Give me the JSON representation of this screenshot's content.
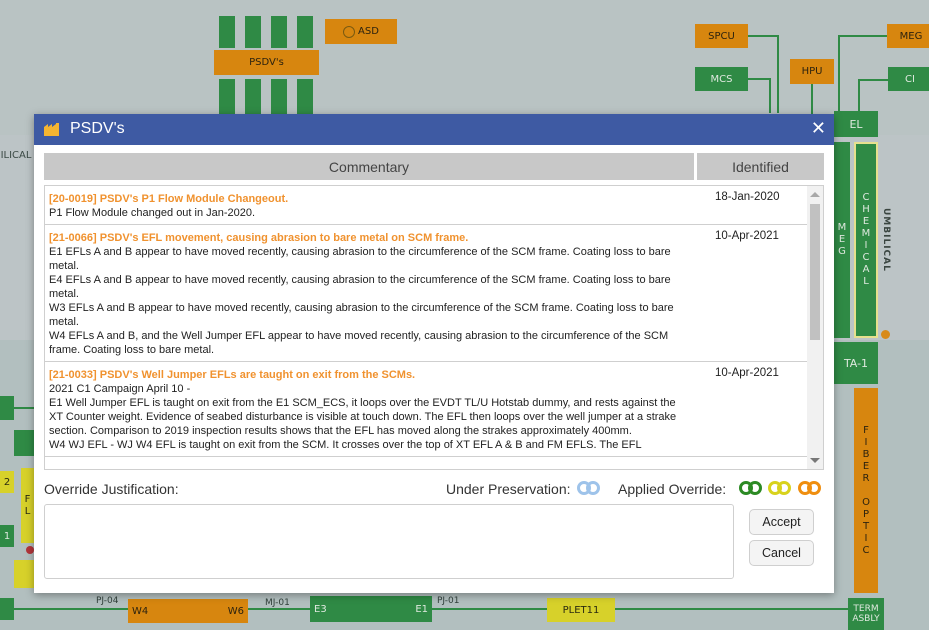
{
  "background": {
    "labels": {
      "asd": "ASD",
      "psdvs": "PSDV's",
      "spcu": "SPCU",
      "meg": "MEG",
      "mcs": "MCS",
      "hpu": "HPU",
      "ci": "CI",
      "ilical": "ILICAL",
      "el": "EL",
      "meg_vertical": "MEG",
      "chemical": "CHEMICAL",
      "umbilical": "UMBILICAL",
      "ta1": "TA-1",
      "fiber_optic": "FIBER OPTIC",
      "term": "TERM",
      "asbly": "ASBLY",
      "pj04": "PJ-04",
      "w4": "W4",
      "w6": "W6",
      "mj01": "MJ-01",
      "e3": "E3",
      "e1": "E1",
      "pj01": "PJ-01",
      "plet11": "PLET11",
      "num2": "2",
      "num3": "3",
      "num1": "1",
      "fl": "FL"
    }
  },
  "dialog": {
    "title": "PSDV's",
    "close_symbol": "✕",
    "columns": {
      "commentary": "Commentary",
      "identified": "Identified"
    },
    "entries": [
      {
        "title": "[20-0019] PSDV's P1 Flow Module Changeout.",
        "body": "P1 Flow Module changed out in Jan-2020.",
        "date": "18-Jan-2020"
      },
      {
        "title": "[21-0066] PSDV's EFL movement, causing abrasion to bare metal on SCM frame.",
        "body": "E1 EFLs A and B appear to have moved recently, causing abrasion to the circumference of the SCM frame. Coating loss to bare metal.\nE4 EFLs A and B appear to have moved recently, causing abrasion to the circumference of the SCM frame. Coating loss to bare metal.\nW3 EFLs A and B appear to have moved recently, causing abrasion to the circumference of the SCM frame. Coating loss to bare metal.\nW4 EFLs A and B, and the Well Jumper EFL appear to have moved recently, causing abrasion to the circumference of the SCM frame. Coating loss to bare metal.",
        "date": "10-Apr-2021"
      },
      {
        "title": "[21-0033] PSDV's Well Jumper EFLs are taught on exit from the SCMs.",
        "body": "2021 C1 Campaign April 10 -\nE1 Well Jumper EFL is taught on exit from the E1 SCM_ECS, it loops over the EVDT TL/U Hotstab dummy, and rests against the XT Counter weight. Evidence of seabed disturbance is visible at touch down. The EFL then loops over the well jumper at a strake section. Comparison to 2019 inspection results shows that the EFL has moved along the strakes approximately 400mm.\nW4 WJ EFL - WJ W4 EFL is taught on exit from the SCM. It crosses over the top of XT EFL A & B and FM EFLS. The EFL",
        "date": "10-Apr-2021"
      }
    ],
    "override_label": "Override Justification:",
    "preservation_label": "Under Preservation:",
    "applied_label": "Applied Override:",
    "justification_value": "",
    "accept_label": "Accept",
    "cancel_label": "Cancel",
    "colors": {
      "titlebar": "#3e5aa3",
      "entry_title": "#f0922f",
      "toggle_blue": "#9ec3ea",
      "toggle_green": "#2c8a24",
      "toggle_yellow": "#d8d21c",
      "toggle_orange": "#ef8e0f"
    }
  }
}
